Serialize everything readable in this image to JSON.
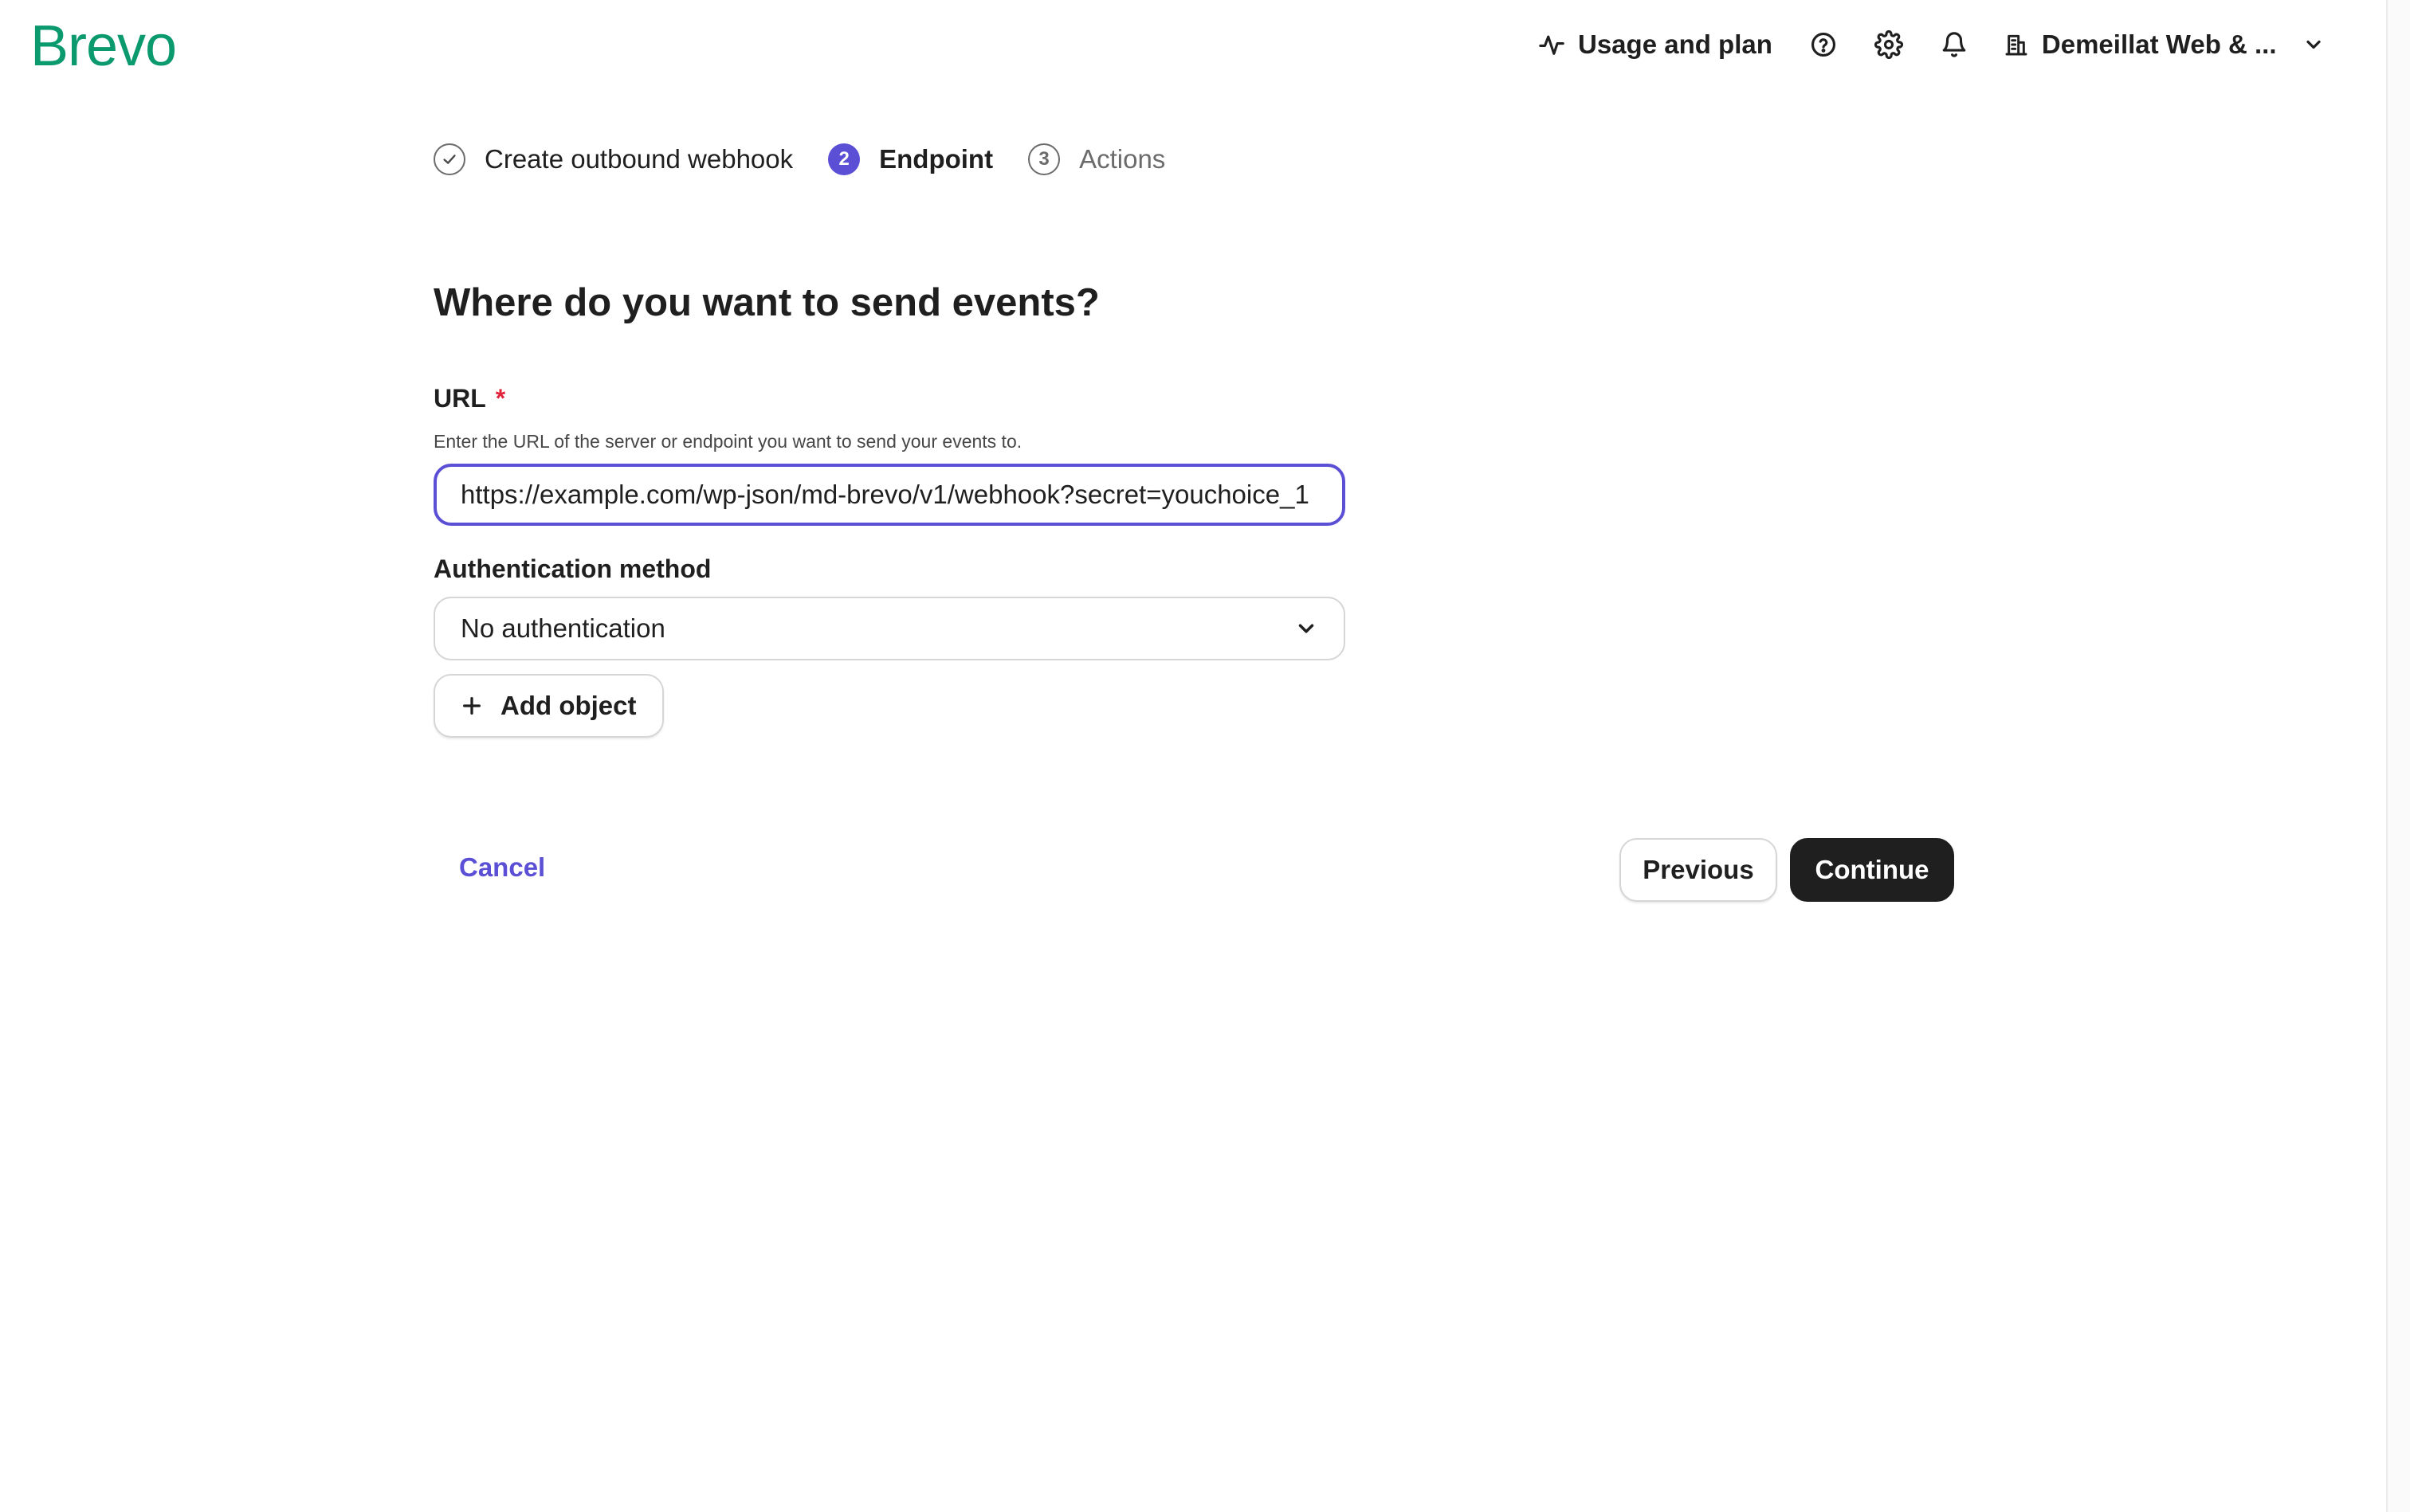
{
  "header": {
    "logo": "Brevo",
    "usage_label": "Usage and plan",
    "help_icon": "help-circle-icon",
    "settings_icon": "gear-icon",
    "notifications_icon": "bell-icon",
    "account_name": "Demeillat Web & ..."
  },
  "stepper": {
    "steps": [
      {
        "label": "Create outbound webhook",
        "status": "done",
        "marker": ""
      },
      {
        "label": "Endpoint",
        "status": "active",
        "marker": "2"
      },
      {
        "label": "Actions",
        "status": "future",
        "marker": "3"
      }
    ]
  },
  "form": {
    "title": "Where do you want to send events?",
    "url_label": "URL",
    "url_required": "*",
    "url_helper": "Enter the URL of the server or endpoint you want to send your events to.",
    "url_value": "https://example.com/wp-json/md-brevo/v1/webhook?secret=youchoice_1",
    "auth_label": "Authentication method",
    "auth_selected": "No authentication",
    "add_object_label": "Add object"
  },
  "footer": {
    "cancel_label": "Cancel",
    "previous_label": "Previous",
    "continue_label": "Continue"
  },
  "colors": {
    "brand_green": "#0b996e",
    "accent_purple": "#5b4fd6",
    "required_red": "#e0243c",
    "primary_button": "#1f1f1f"
  }
}
